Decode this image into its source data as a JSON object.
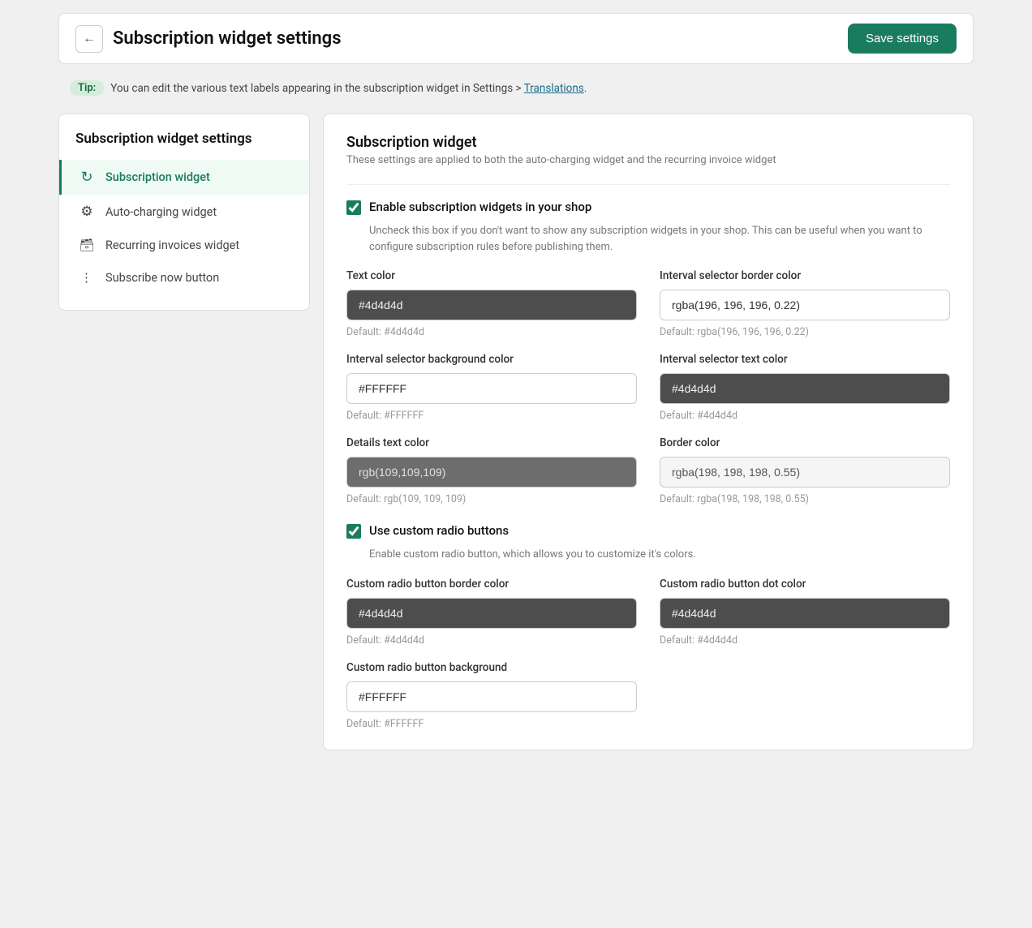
{
  "header": {
    "title": "Subscription widget settings",
    "save_label": "Save settings"
  },
  "tip": {
    "badge": "Tip:",
    "text": "You can edit the various text labels appearing in the subscription widget in Settings > ",
    "link_text": "Translations",
    "suffix": "."
  },
  "sidebar": {
    "title": "Subscription widget settings",
    "items": [
      {
        "id": "subscription-widget",
        "label": "Subscription widget",
        "icon": "↻",
        "active": true
      },
      {
        "id": "auto-charging-widget",
        "label": "Auto-charging widget",
        "icon": "⚙",
        "active": false
      },
      {
        "id": "recurring-invoices-widget",
        "label": "Recurring invoices widget",
        "icon": "🧾",
        "active": false
      },
      {
        "id": "subscribe-now-button",
        "label": "Subscribe now button",
        "icon": "⠿",
        "active": false
      }
    ]
  },
  "main": {
    "section_title": "Subscription widget",
    "section_subtitle": "These settings are applied to both the auto-charging widget and the recurring invoice widget",
    "enable_checkbox_label": "Enable subscription widgets in your shop",
    "enable_checkbox_checked": true,
    "enable_checkbox_desc": "Uncheck this box if you don't want to show any subscription widgets in your shop. This can be useful when you want to configure subscription rules before publishing them.",
    "fields": [
      {
        "id": "text-color",
        "label": "Text color",
        "value": "#4d4d4d",
        "default": "Default: #4d4d4d",
        "style": "dark"
      },
      {
        "id": "interval-selector-border-color",
        "label": "Interval selector border color",
        "value": "rgba(196, 196, 196, 0.22)",
        "default": "Default: rgba(196, 196, 196, 0.22)",
        "style": "light"
      },
      {
        "id": "interval-selector-bg-color",
        "label": "Interval selector background color",
        "value": "#FFFFFF",
        "default": "Default: #FFFFFF",
        "style": "light"
      },
      {
        "id": "interval-selector-text-color",
        "label": "Interval selector text color",
        "value": "#4d4d4d",
        "default": "Default: #4d4d4d",
        "style": "dark"
      },
      {
        "id": "details-text-color",
        "label": "Details text color",
        "value": "rgb(109,109,109)",
        "default": "Default: rgb(109, 109, 109)",
        "style": "dark-medium"
      },
      {
        "id": "border-color",
        "label": "Border color",
        "value": "rgba(198, 198, 198, 0.55)",
        "default": "Default: rgba(198, 198, 198, 0.55)",
        "style": "light-gray"
      }
    ],
    "custom_radio_checkbox_label": "Use custom radio buttons",
    "custom_radio_checkbox_checked": true,
    "custom_radio_checkbox_desc": "Enable custom radio button, which allows you to customize it's colors.",
    "radio_fields": [
      {
        "id": "custom-radio-border-color",
        "label": "Custom radio button border color",
        "value": "#4d4d4d",
        "default": "Default: #4d4d4d",
        "style": "dark"
      },
      {
        "id": "custom-radio-dot-color",
        "label": "Custom radio button dot color",
        "value": "#4d4d4d",
        "default": "Default: #4d4d4d",
        "style": "dark"
      },
      {
        "id": "custom-radio-background",
        "label": "Custom radio button background",
        "value": "#FFFFFF",
        "default": "Default: #FFFFFF",
        "style": "light",
        "single": true
      }
    ]
  }
}
